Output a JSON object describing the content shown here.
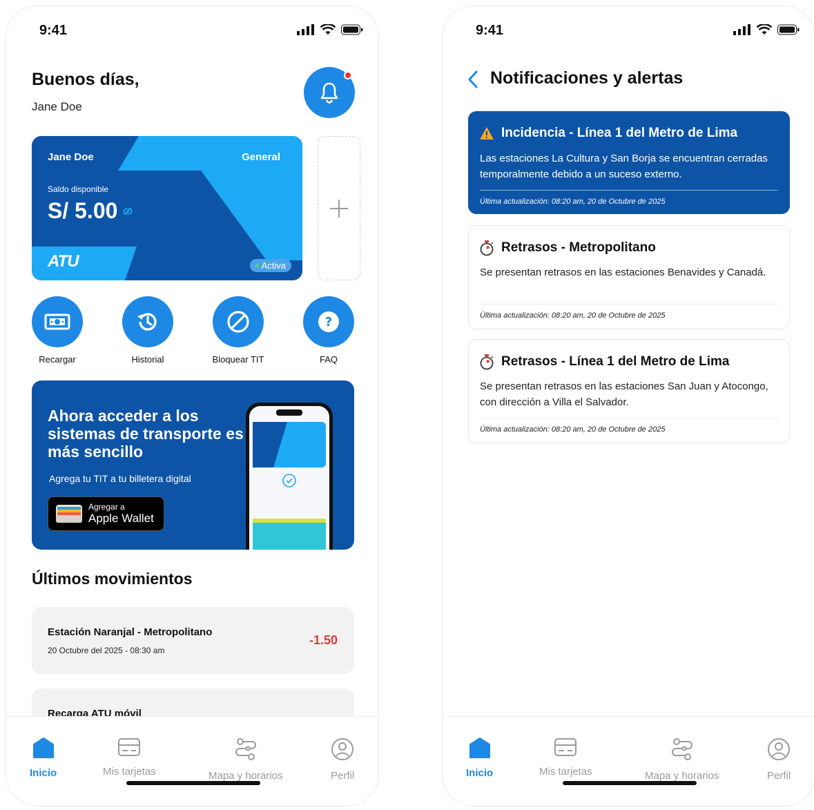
{
  "status_bar": {
    "time": "9:41"
  },
  "home": {
    "greeting": "Buenos días,",
    "user_name": "Jane Doe",
    "card": {
      "holder": "Jane Doe",
      "type": "General",
      "balance_label": "Saldo disponible",
      "balance": "S/ 5.00",
      "logo": "ATU",
      "status": "Activa"
    },
    "actions": [
      {
        "label": "Recargar",
        "icon": "money-icon"
      },
      {
        "label": "Historial",
        "icon": "history-icon"
      },
      {
        "label": "Bloquear TIT",
        "icon": "block-icon"
      },
      {
        "label": "FAQ",
        "icon": "help-icon"
      }
    ],
    "promo": {
      "title": "Ahora acceder a los sistemas de transporte es más sencillo",
      "subtitle": "Agrega tu TIT a tu billetera digital",
      "wallet_line1": "Agregar a",
      "wallet_line2": "Apple Wallet"
    },
    "movements_title": "Últimos movimientos",
    "movements": [
      {
        "title": "Estación Naranjal - Metropolitano",
        "date": "20 Octubre del 2025 - 08:30 am",
        "amount": "-1.50"
      },
      {
        "title": "Recarga ATU móvil",
        "date": "",
        "amount": ""
      }
    ]
  },
  "notifications": {
    "title": "Notificaciones y alertas",
    "items": [
      {
        "title": "Incidencia - Línea 1 del Metro de Lima",
        "body": "Las estaciones La Cultura y San Borja se encuentran cerradas temporalmente debido a un suceso externo.",
        "updated": "Última actualización: 08:20 am,  20 de Octubre de 2025",
        "icon": "warning-icon"
      },
      {
        "title": "Retrasos - Metropolitano",
        "body": "Se presentan retrasos en las estaciones Benavides y Canadá.",
        "updated": "Última actualización: 08:20 am,  20 de Octubre de 2025",
        "icon": "stopwatch-icon"
      },
      {
        "title": "Retrasos - Línea 1 del Metro de Lima",
        "body": "Se presentan retrasos en las estaciones San Juan y Atocongo, con dirección a Villa el Salvador.",
        "updated": "Última actualización: 08:20 am,  20 de Octubre de 2025",
        "icon": "stopwatch-icon"
      }
    ]
  },
  "nav": {
    "items": [
      {
        "label": "Inicio",
        "icon": "home-icon"
      },
      {
        "label": "Mis tarjetas",
        "icon": "card-icon"
      },
      {
        "label": "Mapa y horarios",
        "icon": "route-icon"
      },
      {
        "label": "Perfil",
        "icon": "user-icon"
      }
    ]
  },
  "colors": {
    "primary": "#0d54a7",
    "accent": "#1e88e5",
    "light": "#1ea9f5",
    "danger": "#e53935"
  }
}
